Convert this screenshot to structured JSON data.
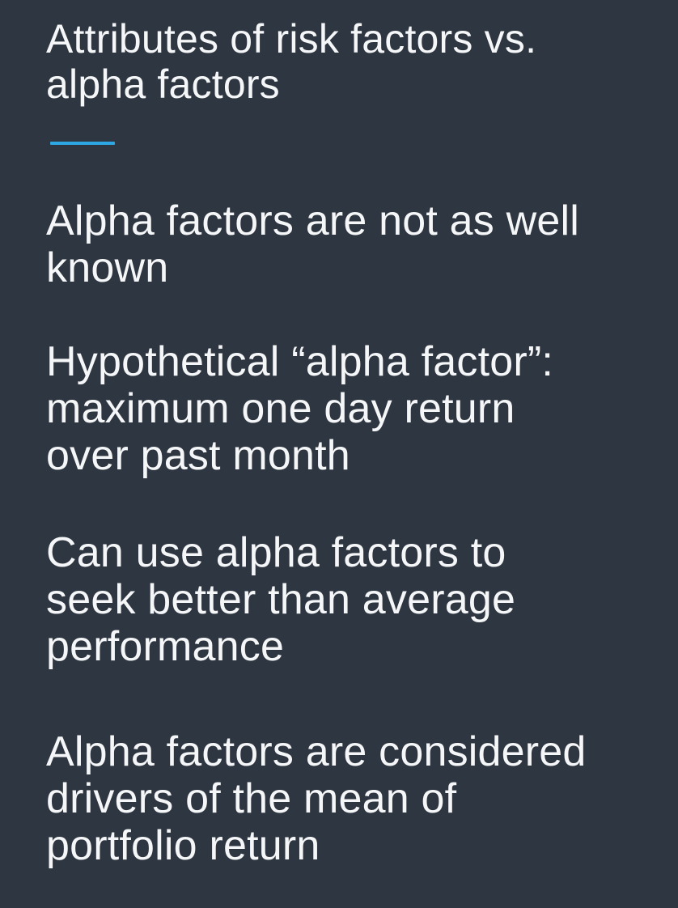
{
  "slide": {
    "title": "Attributes of risk factors vs.\nalpha factors",
    "accent_color": "#2ea8e5",
    "background_color": "#2e3641",
    "points": [
      "Alpha factors are not as well\nknown",
      "Hypothetical “alpha factor”:\nmaximum one day return\nover past month",
      "Can use alpha factors to\nseek better than average\nperformance",
      "Alpha factors are considered\ndrivers of the mean of\nportfolio return"
    ]
  }
}
